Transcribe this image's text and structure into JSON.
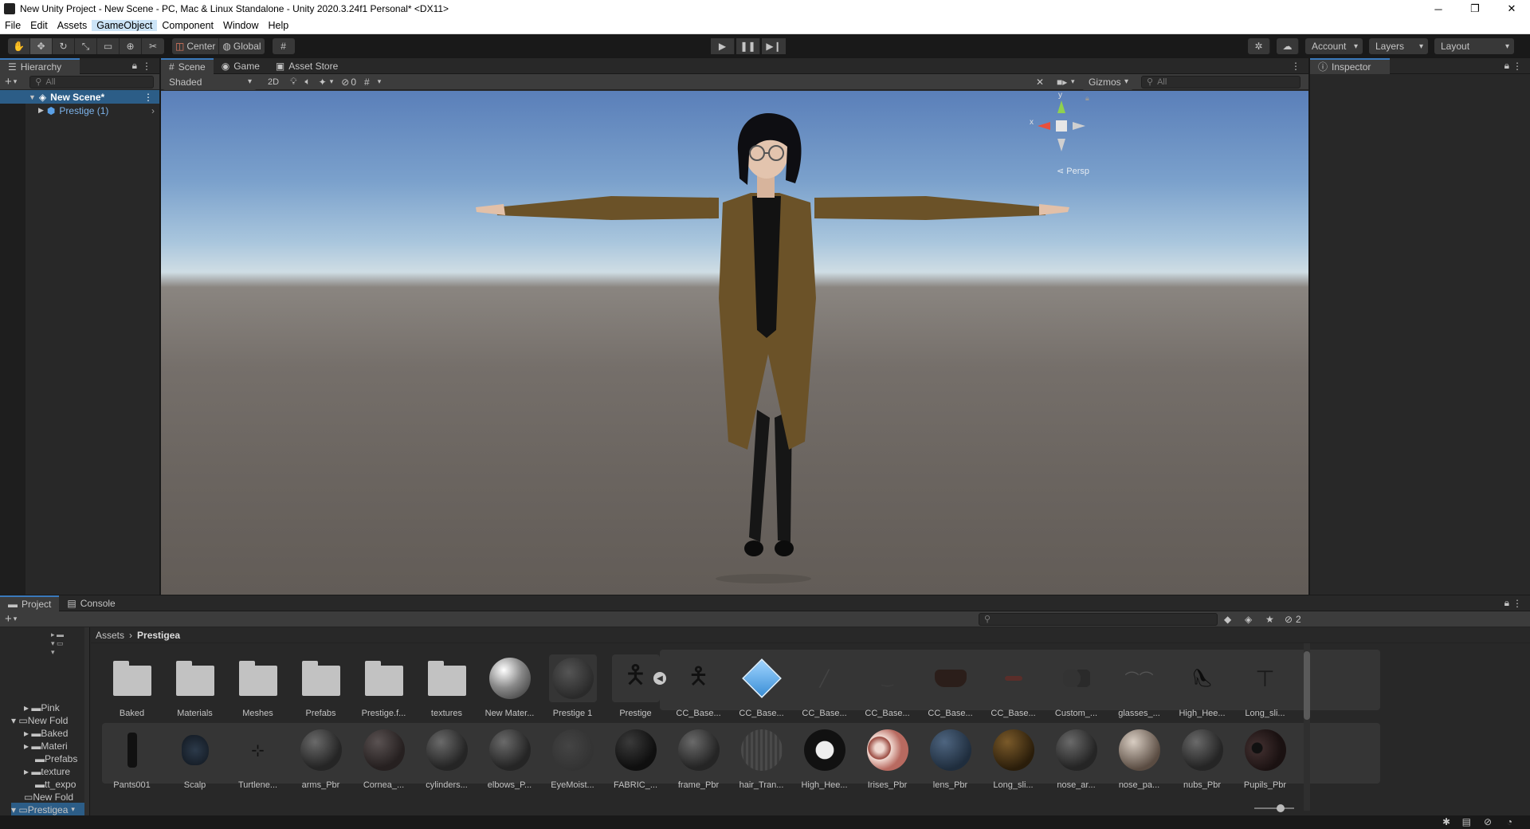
{
  "window": {
    "title": "New Unity Project - New Scene - PC, Mac & Linux Standalone - Unity 2020.3.24f1 Personal* <DX11>",
    "controls": [
      "─",
      "❐",
      "✕"
    ]
  },
  "menu": [
    "File",
    "Edit",
    "Assets",
    "GameObject",
    "Component",
    "Window",
    "Help"
  ],
  "toolbar": {
    "pivot": "Center",
    "space": "Global",
    "account": "Account",
    "layers": "Layers",
    "layout": "Layout"
  },
  "hierarchy": {
    "tab": "Hierarchy",
    "add": "+",
    "search_placeholder": "All",
    "scene": "New Scene*",
    "child": "Prestige (1)"
  },
  "scene_view": {
    "tabs": [
      "Scene",
      "Game",
      "Asset Store"
    ],
    "shading": "Shaded",
    "mode_2d": "2D",
    "hidden_count": "0",
    "gizmos": "Gizmos",
    "search_placeholder": "All",
    "persp": "Persp",
    "axis_x": "x",
    "axis_y": "y"
  },
  "inspector": {
    "tab": "Inspector"
  },
  "project": {
    "tabs": [
      "Project",
      "Console"
    ],
    "add": "+",
    "hidden_count": "2",
    "breadcrumb_root": "Assets",
    "breadcrumb_leaf": "Prestigea",
    "tree": [
      "Pink",
      "New Fold",
      "Baked",
      "Materi",
      "Prefabs",
      "texture",
      "tt_expo",
      "New Fold",
      "Prestigea"
    ],
    "row1": [
      "Baked",
      "Materials",
      "Meshes",
      "Prefabs",
      "Prestige.f...",
      "textures",
      "New Mater...",
      "Prestige 1",
      "Prestige",
      "CC_Base...",
      "CC_Base...",
      "CC_Base...",
      "CC_Base...",
      "CC_Base...",
      "CC_Base...",
      "Custom_...",
      "glasses_...",
      "High_Hee...",
      "Long_sli..."
    ],
    "row2": [
      "Pants001",
      "Scalp",
      "Turtlene...",
      "arms_Pbr",
      "Cornea_...",
      "cylinders...",
      "elbows_P...",
      "EyeMoist...",
      "FABRIC_...",
      "frame_Pbr",
      "hair_Tran...",
      "High_Hee...",
      "Irises_Pbr",
      "lens_Pbr",
      "Long_sli...",
      "nose_ar...",
      "nose_pa...",
      "nubs_Pbr",
      "Pupils_Pbr"
    ]
  },
  "colors": {
    "accent": "#3a79bb",
    "selection": "#2c5d87",
    "panel": "#282828",
    "coat": "#6b5228"
  }
}
